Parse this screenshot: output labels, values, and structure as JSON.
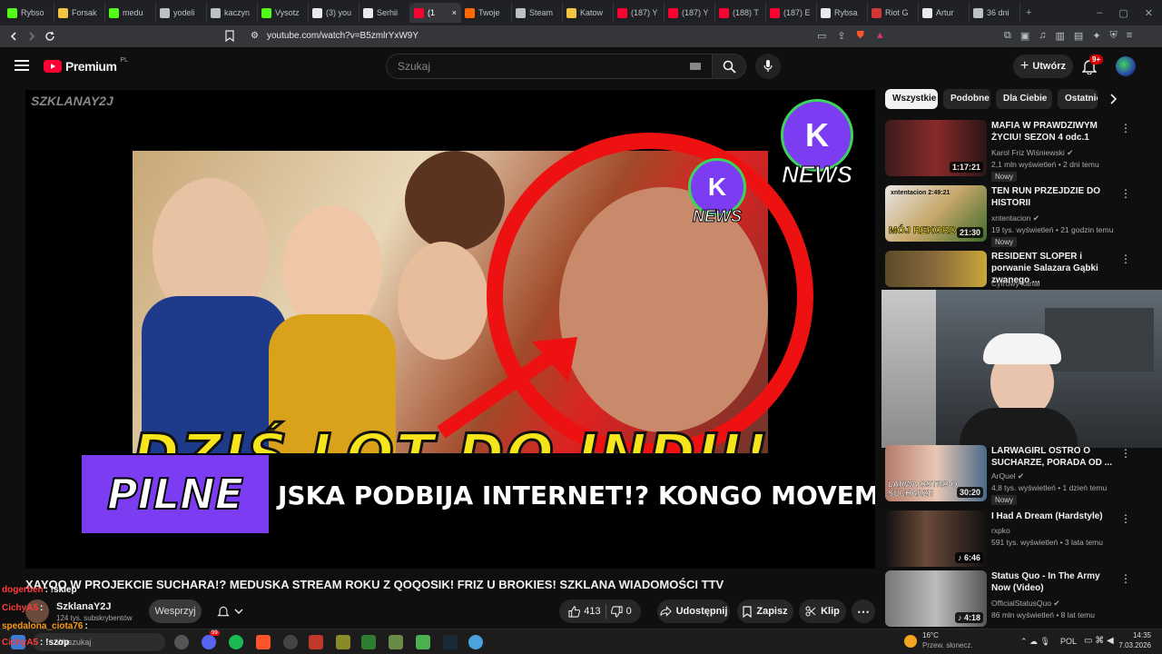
{
  "browser": {
    "tabs": [
      {
        "label": "Rybso",
        "color": "#53fc18"
      },
      {
        "label": "Forsak",
        "color": "#f4c542"
      },
      {
        "label": "medu",
        "color": "#53fc18"
      },
      {
        "label": "yodeli",
        "color": "#bdc1c6"
      },
      {
        "label": "kaczyn",
        "color": "#bdc1c6"
      },
      {
        "label": "Vysotz",
        "color": "#53fc18"
      },
      {
        "label": "(3) you",
        "color": "#e8eaed"
      },
      {
        "label": "Serhii",
        "color": "#e8eaed"
      },
      {
        "label": "(1",
        "color": "#ff0033"
      },
      {
        "label": "Twoje",
        "color": "#ff6a00"
      },
      {
        "label": "Steam",
        "color": "#bdc1c6"
      },
      {
        "label": "Katow",
        "color": "#f4c542"
      },
      {
        "label": "(187) Y",
        "color": "#ff0033"
      },
      {
        "label": "(187) Y",
        "color": "#ff0033"
      },
      {
        "label": "(188) T",
        "color": "#ff0033"
      },
      {
        "label": "(187) E",
        "color": "#ff0033"
      },
      {
        "label": "Rybsa",
        "color": "#e8eaed"
      },
      {
        "label": "Riot G",
        "color": "#d13639"
      },
      {
        "label": "Artur",
        "color": "#e8eaed"
      },
      {
        "label": "36 dni",
        "color": "#bdc1c6"
      }
    ],
    "url": "youtube.com/watch?v=B5zmlrYxW9Y"
  },
  "header": {
    "logo": "Premium",
    "logo_region": "PL",
    "search_placeholder": "Szukaj",
    "create_label": "Utwórz",
    "notifications_badge": "9+"
  },
  "video": {
    "watermark": "SZKLANAY2J",
    "thumb_headline": "DZIŚ LOT DO INDII!",
    "news_logo_text": "NEWS",
    "banner_tag": "PILNE",
    "ticker": "JSKA PODBIJA INTERNET!? KONGO MOVEMENT!",
    "title": "XAYOO W PROJEKCIE SUCHARA!? MEDUSKA STREAM ROKU Z QOQOSIK! FRIZ U BROKIES! SZKLANA WIADOMOŚCI TTV",
    "channel_name": "SzklanaY2J",
    "subscribers": "124 tys. subskrybentów",
    "support_label": "Wesprzyj",
    "likes": "413",
    "dislikes": "0",
    "share_label": "Udostępnij",
    "save_label": "Zapisz",
    "clip_label": "Klip"
  },
  "sidebar": {
    "chips": [
      "Wszystkie",
      "Podobne",
      "Dla Ciebie",
      "Ostatnio"
    ],
    "recommendations": [
      {
        "title": "MAFIA W PRAWDZIWYM ŻYCIU! SEZON 4 odc.1",
        "channel": "Karol Friz Wiśniewski",
        "meta": "2,1 mln wyświetleń • 2 dni temu",
        "badge": "Nowy",
        "duration": "1:17:21"
      },
      {
        "title": "TEN RUN PRZEJDZIE DO HISTORII",
        "channel": "xntentacion",
        "meta": "19 tys. wyświetleń • 21 godzin temu",
        "badge": "Nowy",
        "duration": "21:30",
        "thumb_text": "MÓJ REKORD",
        "thumb_top": "xntentacion 2:49:21"
      },
      {
        "title": "RESIDENT SLOPER i porwanie Salazara Gąbki zwanego ...",
        "channel": "Cyfrowy kanał",
        "meta": "",
        "badge": "",
        "duration": ""
      },
      {
        "title": "LARWAGIRL OSTRO O SUCHARZE, PORADA OD ...",
        "channel": "ArQuel",
        "meta": "4,8 tys. wyświetleń • 1 dzień temu",
        "badge": "Nowy",
        "duration": "30:20",
        "thumb_text": "LARWA OSTRO O SUCHARZE"
      },
      {
        "title": "I Had A Dream (Hardstyle)",
        "channel": "rxpko",
        "meta": "591 tys. wyświetleń • 3 lata temu",
        "badge": "",
        "duration": "6:46"
      },
      {
        "title": "Status Quo - In The Army Now (Video)",
        "channel": "OfficialStatusQuo",
        "meta": "86 mln wyświetleń • 8 lat temu",
        "badge": "",
        "duration": "4:18"
      }
    ]
  },
  "chat": [
    {
      "user": "dogerben",
      "color": "#ff3b3b",
      "msg": ": !sklep"
    },
    {
      "user": "CichyA5",
      "color": "#ff3b3b",
      "msg": ":"
    },
    {
      "user": "spedalona_ciota76",
      "color": "#ff9b1a",
      "msg": ":"
    },
    {
      "user": "CichyA5",
      "color": "#ff3b3b",
      "msg": ": !szop"
    }
  ],
  "taskbar": {
    "search_placeholder": "Wyszukaj",
    "weather_temp": "16°C",
    "weather_desc": "Przew. słonecz.",
    "language": "POL",
    "time": "14:35",
    "date": "7.03.2026",
    "discord_badge": "99"
  }
}
